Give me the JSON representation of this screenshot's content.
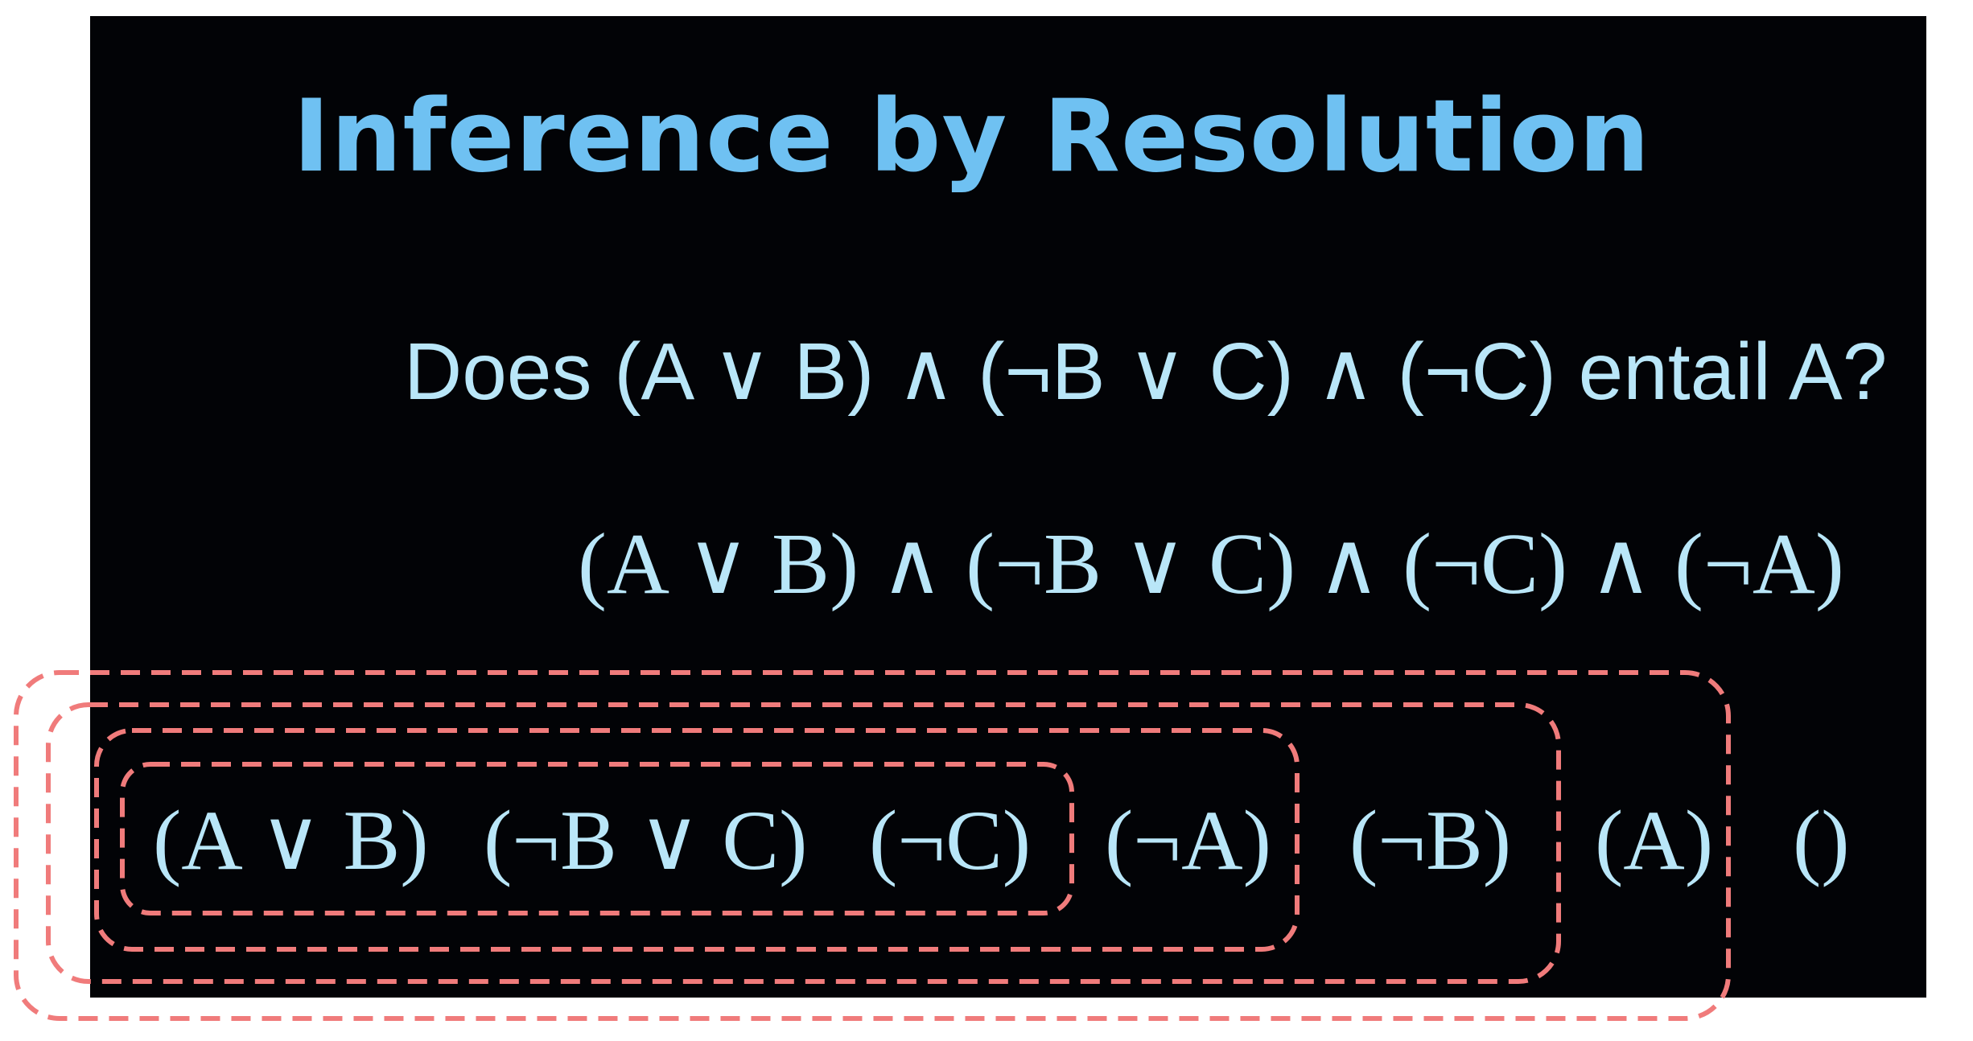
{
  "slide": {
    "title": "Inference by Resolution",
    "question": "Does (A ∨ B) ∧ (¬B ∨ C) ∧ (¬C) entail A?",
    "expression": "(A ∨ B) ∧ (¬B ∨ C) ∧ (¬C) ∧ (¬A)"
  },
  "clauses": [
    "(A ∨ B)",
    "(¬B ∨ C)",
    "(¬C)",
    "(¬A)",
    "(¬B)",
    "(A)",
    "()"
  ],
  "colors": {
    "background": "#020306",
    "title": "#6fc1f2",
    "text": "#b9e6f8",
    "highlight": "#f07b7b"
  }
}
